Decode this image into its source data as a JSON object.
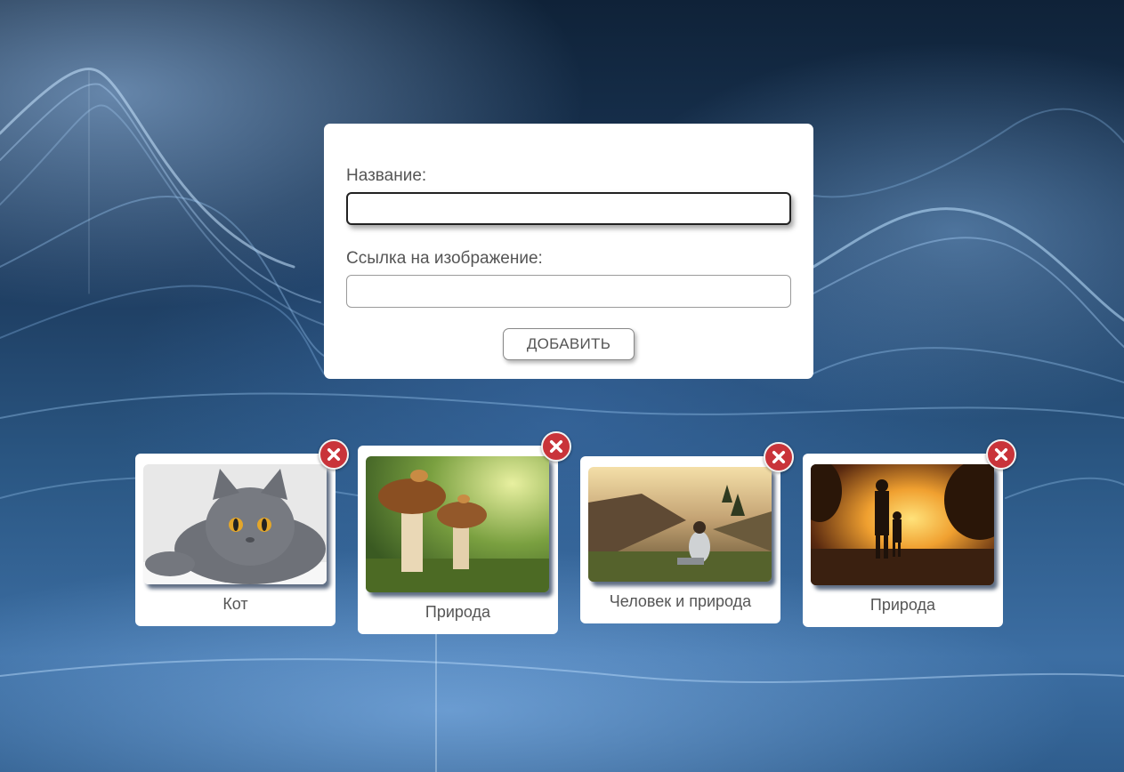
{
  "form": {
    "title_label": "Название:",
    "title_value": "",
    "link_label": "Ссылка на изображение:",
    "link_value": "",
    "submit_label": "ДОБАВИТЬ"
  },
  "cards": [
    {
      "caption": "Кот",
      "image_icon": "cat-photo",
      "delete_icon": "close-icon"
    },
    {
      "caption": "Природа",
      "image_icon": "mushrooms-photo",
      "delete_icon": "close-icon"
    },
    {
      "caption": "Человек и природа",
      "image_icon": "mountain-view-photo",
      "delete_icon": "close-icon"
    },
    {
      "caption": "Природа",
      "image_icon": "sunset-walk-photo",
      "delete_icon": "close-icon"
    }
  ],
  "colors": {
    "delete_button": "#c9343a",
    "card_background": "#ffffff",
    "text": "#555555"
  }
}
